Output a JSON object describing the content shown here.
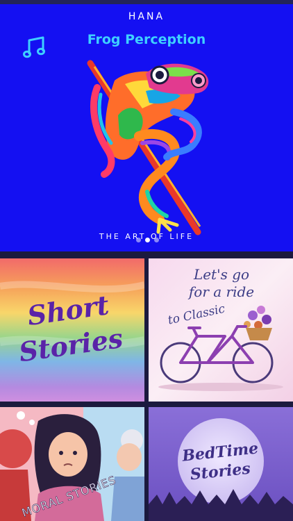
{
  "app": {
    "brand": "HANA"
  },
  "featured": {
    "title": "Frog Perception",
    "tagline": "THE ART OF LIFE",
    "icon": "music-note-icon",
    "slide_count": 3,
    "active_slide": 2
  },
  "cards": [
    {
      "text_line1": "Short",
      "text_line2": "Stories"
    },
    {
      "text_line1": "Let's go",
      "text_line2": "for a ride",
      "text_line3": "to Classic"
    },
    {
      "text": "MORAL STORIES"
    },
    {
      "text_line1": "BedTime",
      "text_line2": "Stories"
    }
  ],
  "colors": {
    "hero_bg": "#1410f2",
    "title": "#3ed0ff",
    "app_bg": "#1b1a3e"
  }
}
